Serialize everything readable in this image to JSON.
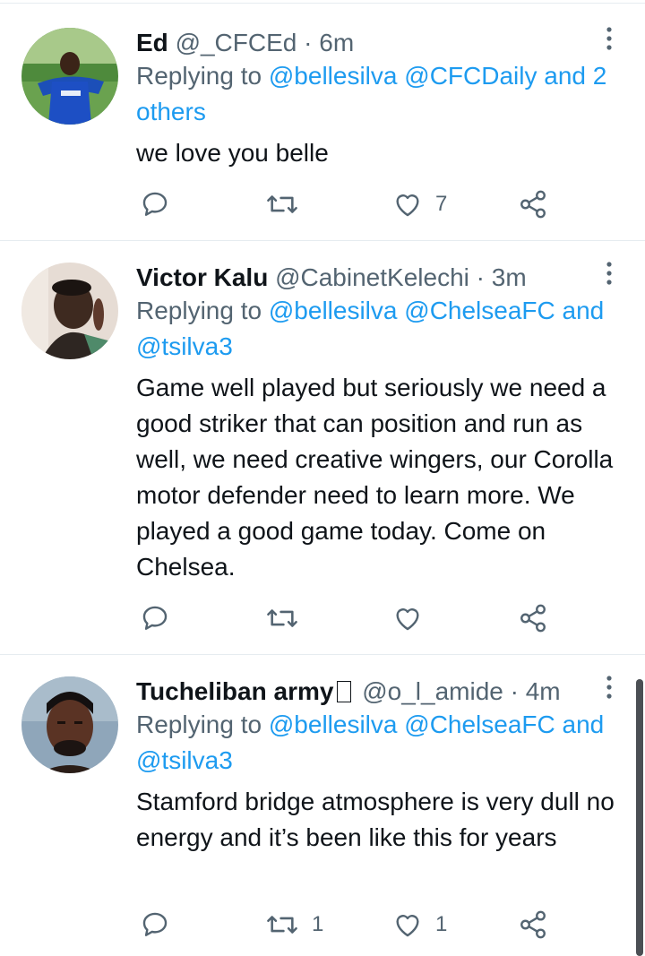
{
  "tweets": [
    {
      "name": "Ed",
      "handle": "@_CFCEd",
      "dot": "·",
      "time": "6m",
      "replying_prefix": "Replying to",
      "mentions": [
        "@bellesilva",
        "@CFCDaily",
        "and 2 others"
      ],
      "text": "we love you belle",
      "reply_count": "",
      "retweet_count": "",
      "like_count": "7"
    },
    {
      "name": "Victor Kalu",
      "handle": "@CabinetKelechi",
      "dot": "·",
      "time": "3m",
      "replying_prefix": "Replying to",
      "mentions": [
        "@bellesilva",
        "@ChelseaFC",
        "and",
        "@tsilva3"
      ],
      "text": "Game well played but seriously we need a good striker that can position and run as well, we need creative wingers, our Corolla motor defender need to learn more. We played a good game today. Come on Chelsea.",
      "reply_count": "",
      "retweet_count": "",
      "like_count": ""
    },
    {
      "name": "Tucheliban army",
      "handle": "@o_l_amide",
      "dot": "·",
      "time": "4m",
      "replying_prefix": "Replying to",
      "mentions": [
        "@bellesilva",
        "@ChelseaFC",
        "and",
        "@tsilva3"
      ],
      "text": "Stamford bridge atmosphere is very dull no energy and it’s been like this for years",
      "reply_count": "",
      "retweet_count": "1",
      "like_count": "1"
    }
  ],
  "icons": {
    "reply": "reply-icon",
    "retweet": "retweet-icon",
    "like": "heart-icon",
    "share": "share-icon",
    "more": "more-vertical-icon"
  },
  "colors": {
    "link": "#1d9bf0",
    "secondary": "#536471",
    "text": "#0f1419",
    "divider": "#e6ecf0"
  }
}
